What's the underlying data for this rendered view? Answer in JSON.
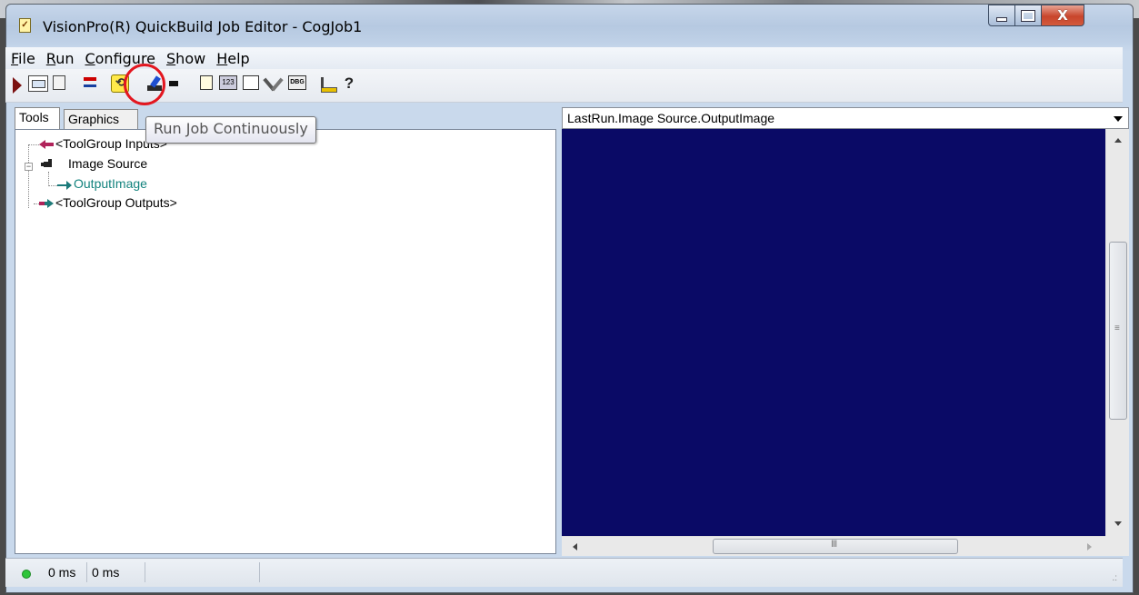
{
  "window": {
    "title": "VisionPro(R) QuickBuild Job Editor - CogJob1",
    "app_icon": "checklist-icon"
  },
  "title_buttons": {
    "minimize_icon": "minimize-icon",
    "maximize_icon": "maximize-icon",
    "close_glyph": "X"
  },
  "menu": {
    "items": [
      {
        "accel": "F",
        "rest": "ile"
      },
      {
        "accel": "R",
        "rest": "un"
      },
      {
        "accel": "C",
        "rest": "onfigure"
      },
      {
        "accel": "S",
        "rest": "how"
      },
      {
        "accel": "H",
        "rest": "elp"
      }
    ]
  },
  "toolbar": {
    "icons": [
      "run-once-icon",
      "step-icon",
      "run-settings-icon",
      "red-import-icon",
      "run-continuous-icon",
      "edit-brush-icon",
      "camera-icon",
      "notes-icon",
      "number-display-icon",
      "grid-icon",
      "tools-icon",
      "debug-icon",
      "ruler-icon",
      "help-icon"
    ],
    "icon_123": "123",
    "icon_dbg": "DBG",
    "icon_help": "?",
    "highlight_color": "#e3161f"
  },
  "tooltip": {
    "text": "Run Job Continuously"
  },
  "left_tabs": {
    "tools": "Tools",
    "graphics": "Graphics"
  },
  "tree": {
    "inputs": "<ToolGroup Inputs>",
    "image_source": "Image Source",
    "output_image": "OutputImage",
    "outputs": "<ToolGroup Outputs>",
    "expander": "−"
  },
  "display": {
    "selector": "LastRun.Image Source.OutputImage",
    "background_color": "#0a0a66"
  },
  "scroll": {
    "v_grip": "≡",
    "h_grip": "III"
  },
  "status": {
    "indicator_color": "#2ec53a",
    "time1": "0 ms",
    "time2": "0 ms"
  }
}
